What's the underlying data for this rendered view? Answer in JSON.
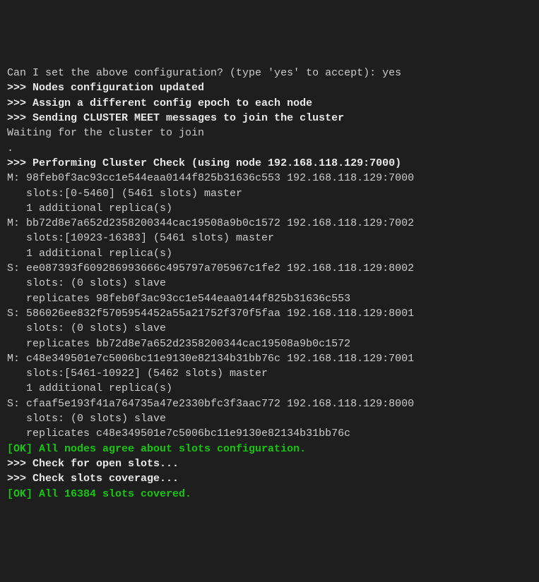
{
  "lines": [
    {
      "cls": "normal",
      "text": "Can I set the above configuration? (type 'yes' to accept): yes"
    },
    {
      "cls": "bold",
      "text": ">>> Nodes configuration updated"
    },
    {
      "cls": "bold",
      "text": ">>> Assign a different config epoch to each node"
    },
    {
      "cls": "bold",
      "text": ">>> Sending CLUSTER MEET messages to join the cluster"
    },
    {
      "cls": "normal",
      "text": "Waiting for the cluster to join"
    },
    {
      "cls": "normal",
      "text": "."
    },
    {
      "cls": "bold",
      "text": ">>> Performing Cluster Check (using node 192.168.118.129:7000)"
    },
    {
      "cls": "normal",
      "text": "M: 98feb0f3ac93cc1e544eaa0144f825b31636c553 192.168.118.129:7000"
    },
    {
      "cls": "normal",
      "text": "   slots:[0-5460] (5461 slots) master"
    },
    {
      "cls": "normal",
      "text": "   1 additional replica(s)"
    },
    {
      "cls": "normal",
      "text": "M: bb72d8e7a652d2358200344cac19508a9b0c1572 192.168.118.129:7002"
    },
    {
      "cls": "normal",
      "text": "   slots:[10923-16383] (5461 slots) master"
    },
    {
      "cls": "normal",
      "text": "   1 additional replica(s)"
    },
    {
      "cls": "normal",
      "text": "S: ee087393f609286993666c495797a705967c1fe2 192.168.118.129:8002"
    },
    {
      "cls": "normal",
      "text": "   slots: (0 slots) slave"
    },
    {
      "cls": "normal",
      "text": "   replicates 98feb0f3ac93cc1e544eaa0144f825b31636c553"
    },
    {
      "cls": "normal",
      "text": "S: 586026ee832f5705954452a55a21752f370f5faa 192.168.118.129:8001"
    },
    {
      "cls": "normal",
      "text": "   slots: (0 slots) slave"
    },
    {
      "cls": "normal",
      "text": "   replicates bb72d8e7a652d2358200344cac19508a9b0c1572"
    },
    {
      "cls": "normal",
      "text": "M: c48e349501e7c5006bc11e9130e82134b31bb76c 192.168.118.129:7001"
    },
    {
      "cls": "normal",
      "text": "   slots:[5461-10922] (5462 slots) master"
    },
    {
      "cls": "normal",
      "text": "   1 additional replica(s)"
    },
    {
      "cls": "normal",
      "text": "S: cfaaf5e193f41a764735a47e2330bfc3f3aac772 192.168.118.129:8000"
    },
    {
      "cls": "normal",
      "text": "   slots: (0 slots) slave"
    },
    {
      "cls": "normal",
      "text": "   replicates c48e349501e7c5006bc11e9130e82134b31bb76c"
    },
    {
      "cls": "green",
      "text": "[OK] All nodes agree about slots configuration."
    },
    {
      "cls": "bold",
      "text": ">>> Check for open slots..."
    },
    {
      "cls": "bold",
      "text": ">>> Check slots coverage..."
    },
    {
      "cls": "green",
      "text": "[OK] All 16384 slots covered."
    }
  ]
}
